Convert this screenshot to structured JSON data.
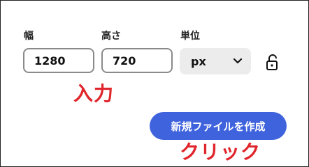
{
  "form": {
    "width_label": "幅",
    "width_value": "1280",
    "height_label": "高さ",
    "height_value": "720",
    "unit_label": "単位",
    "unit_value": "px",
    "unit_icon": "chevron-down-icon",
    "lock_icon": "unlock-icon"
  },
  "actions": {
    "create_label": "新規ファイルを作成"
  },
  "annotations": {
    "input_note": "入力",
    "click_note": "クリック",
    "color": "#e0262c"
  },
  "colors": {
    "primary": "#3e63dd",
    "field_border": "#8a8a8a",
    "select_bg": "#ececec"
  }
}
